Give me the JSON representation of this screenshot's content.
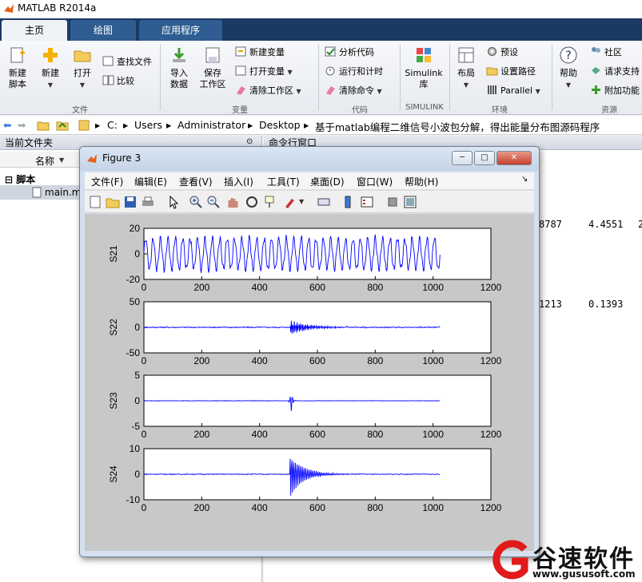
{
  "app": {
    "title": "MATLAB R2014a"
  },
  "tabs": [
    {
      "label": "主页",
      "active": true
    },
    {
      "label": "绘图",
      "active": false
    },
    {
      "label": "应用程序",
      "active": false
    }
  ],
  "ribbon": {
    "file": {
      "group_label": "文件",
      "new_script": "新建\n脚本",
      "new": "新建",
      "open": "打开",
      "find_files": "查找文件",
      "compare": "比较"
    },
    "variable": {
      "group_label": "变量",
      "import_data": "导入\n数据",
      "save_workspace": "保存\n工作区",
      "new_variable": "新建变量",
      "open_variable": "打开变量",
      "clear_workspace": "清除工作区"
    },
    "code": {
      "group_label": "代码",
      "analyze_code": "分析代码",
      "run_and_time": "运行和计时",
      "clear_commands": "清除命令"
    },
    "simulink": {
      "group_label": "SIMULINK",
      "library": "Simulink\n库"
    },
    "environment": {
      "group_label": "环境",
      "layout": "布局",
      "preferences": "预设",
      "set_path": "设置路径",
      "parallel": "Parallel"
    },
    "resources": {
      "group_label": "资源",
      "help": "帮助",
      "community": "社区",
      "request_support": "请求支持",
      "add_ons": "附加功能"
    }
  },
  "address": {
    "path": [
      "C:",
      "Users",
      "Administrator",
      "Desktop",
      "基于matlab编程二维信号小波包分解，得出能量分布图源码程序"
    ]
  },
  "file_panel": {
    "title": "当前文件夹",
    "column_name": "名称",
    "folder": "脚本",
    "file": "main.m"
  },
  "command_panel": {
    "title": "命令行窗口",
    "row1": [
      "8787",
      "4.4551",
      "2"
    ],
    "row2": [
      "1213",
      "0.1393"
    ]
  },
  "figure": {
    "title": "Figure 3",
    "menus": [
      "文件(F)",
      "编辑(E)",
      "查看(V)",
      "插入(I)",
      "工具(T)",
      "桌面(D)",
      "窗口(W)",
      "帮助(H)"
    ],
    "toolbar_icons": [
      "new-figure-icon",
      "open-file-icon",
      "save-icon",
      "print-icon",
      "pointer-icon",
      "zoom-in-icon",
      "zoom-out-icon",
      "pan-icon",
      "rotate-icon",
      "data-cursor-icon",
      "brush-icon",
      "link-icon",
      "colorbar-icon",
      "legend-icon",
      "hide-plot-tools-icon",
      "show-plot-tools-icon"
    ]
  },
  "watermark": {
    "text": "谷速软件",
    "url": "www.gususoft.com"
  },
  "colors": {
    "accent": "#1b3a63",
    "plot_line": "#0000ff"
  },
  "chart_data": [
    {
      "type": "line",
      "ylabel": "S21",
      "xlim": [
        0,
        1200
      ],
      "ylim": [
        -20,
        20
      ],
      "xticks": [
        "0",
        "200",
        "400",
        "600",
        "800",
        "1000",
        "1200"
      ],
      "yticks": [
        "-20",
        "0",
        "20"
      ],
      "series": [
        {
          "x": [
            0,
            1024
          ],
          "values": "oscillation amplitude ≈ 12, ~40 cycles"
        }
      ]
    },
    {
      "type": "line",
      "ylabel": "S22",
      "xlim": [
        0,
        1200
      ],
      "ylim": [
        -50,
        50
      ],
      "xticks": [
        "0",
        "200",
        "400",
        "600",
        "800",
        "1000",
        "1200"
      ],
      "yticks": [
        "-50",
        "0",
        "50"
      ],
      "series": [
        {
          "x": [
            0,
            1024
          ],
          "values": "noise ≈ ±2, burst ≈ 15 at x ≈ 520 decaying to 1024"
        }
      ]
    },
    {
      "type": "line",
      "ylabel": "S23",
      "xlim": [
        0,
        1200
      ],
      "ylim": [
        -5,
        5
      ],
      "xticks": [
        "0",
        "200",
        "400",
        "600",
        "800",
        "1000",
        "1200"
      ],
      "yticks": [
        "-5",
        "0",
        "5"
      ],
      "series": [
        {
          "x": [
            0,
            1024
          ],
          "values": "near zero, spike ≈ 2 at x ≈ 510"
        }
      ]
    },
    {
      "type": "line",
      "ylabel": "S24",
      "xlim": [
        0,
        1200
      ],
      "ylim": [
        -10,
        10
      ],
      "xticks": [
        "0",
        "200",
        "400",
        "600",
        "800",
        "1000",
        "1200"
      ],
      "yticks": [
        "-10",
        "0",
        "10"
      ],
      "series": [
        {
          "x": [
            0,
            1024
          ],
          "values": "near zero, burst ≈ 9 at x ≈ 510 decaying to 750"
        }
      ]
    }
  ]
}
